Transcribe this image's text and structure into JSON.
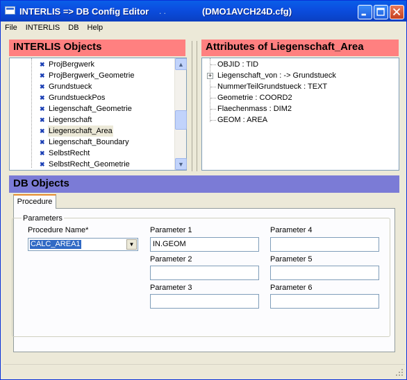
{
  "window": {
    "title": "INTERLIS => DB Config Editor",
    "title_dots": ". .",
    "title_file": "(DMO1AVCH24D.cfg)"
  },
  "menu": [
    "File",
    "INTERLIS",
    "DB",
    "Help"
  ],
  "interlis_panel": {
    "header": "INTERLIS Objects",
    "items": [
      "ProjBergwerk",
      "ProjBergwerk_Geometrie",
      "Grundstueck",
      "GrundstueckPos",
      "Liegenschaft_Geometrie",
      "Liegenschaft",
      "Liegenschaft_Area",
      "Liegenschaft_Boundary",
      "SelbstRecht",
      "SelbstRecht_Geometrie"
    ],
    "selected": "Liegenschaft_Area"
  },
  "attributes_panel": {
    "header": "Attributes of Liegenschaft_Area",
    "items": [
      "OBJID : TID",
      "Liegenschaft_von : -> Grundstueck",
      "NummerTeilGrundstueck : TEXT",
      "Geometrie : COORD2",
      "Flaechenmass : DIM2",
      "GEOM : AREA"
    ],
    "expandable": "+"
  },
  "db_panel": {
    "header": "DB Objects",
    "tab": "Procedure",
    "group_label": "Parameters",
    "procedure_name_label": "Procedure Name*",
    "procedure_name_value": "CALC_AREA1",
    "params": [
      {
        "label": "Parameter 1",
        "value": "IN.GEOM"
      },
      {
        "label": "Parameter 2",
        "value": ""
      },
      {
        "label": "Parameter 3",
        "value": ""
      },
      {
        "label": "Parameter 4",
        "value": ""
      },
      {
        "label": "Parameter 5",
        "value": ""
      },
      {
        "label": "Parameter 6",
        "value": ""
      }
    ]
  },
  "icons": {
    "tree": "class-icon",
    "scroll_up": "▲",
    "scroll_down": "▼",
    "combo_arrow": "▼"
  }
}
